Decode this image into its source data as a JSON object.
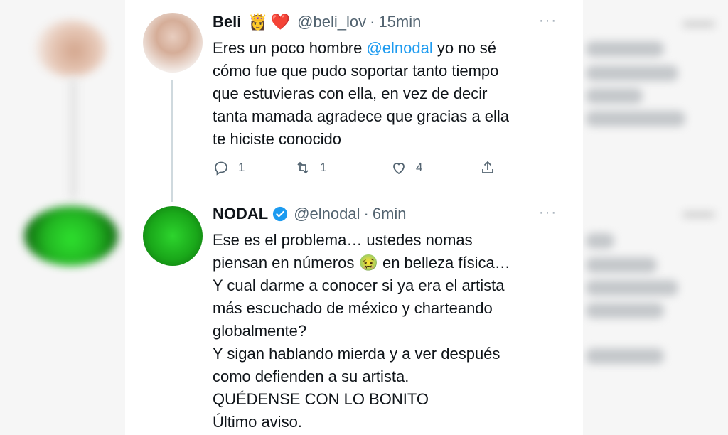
{
  "tweets": [
    {
      "name": "Beli",
      "emojis": [
        "👸",
        "❤️"
      ],
      "handle": "@beli_lov",
      "separator": "·",
      "time": "15min",
      "more": "···",
      "lines": [
        {
          "pre": "Eres un poco hombre ",
          "mention": "@elnodal",
          "post": " yo no sé"
        },
        {
          "pre": "cómo fue que pudo soportar tanto tiempo",
          "mention": "",
          "post": ""
        },
        {
          "pre": "que estuvieras con ella, en vez de decir",
          "mention": "",
          "post": ""
        },
        {
          "pre": "tanta mamada agradece que gracias a ella",
          "mention": "",
          "post": ""
        },
        {
          "pre": "te hiciste conocido",
          "mention": "",
          "post": ""
        }
      ],
      "replies": "1",
      "retweets": "1",
      "likes": "4"
    },
    {
      "name": "NODAL",
      "verified": true,
      "handle": "@elnodal",
      "separator": "·",
      "time": "6min",
      "more": "···",
      "lines": [
        "Ese es el problema… ustedes nomas",
        "piensan en números 🤢 en belleza física…",
        "Y cual darme a conocer si ya era el artista",
        "más escuchado de méxico y charteando",
        "globalmente?",
        "Y sigan hablando mierda y a ver después",
        "como defienden a su artista.",
        "QUÉDENSE CON LO BONITO",
        "Último aviso."
      ]
    }
  ],
  "colors": {
    "mention": "#1d9bf0",
    "verified": "#1d9bf0",
    "secondary_text": "#536471",
    "thread_line": "#cfd9de"
  },
  "icons": [
    "reply-icon",
    "retweet-icon",
    "like-icon",
    "share-icon",
    "verified-badge-icon",
    "more-icon"
  ]
}
